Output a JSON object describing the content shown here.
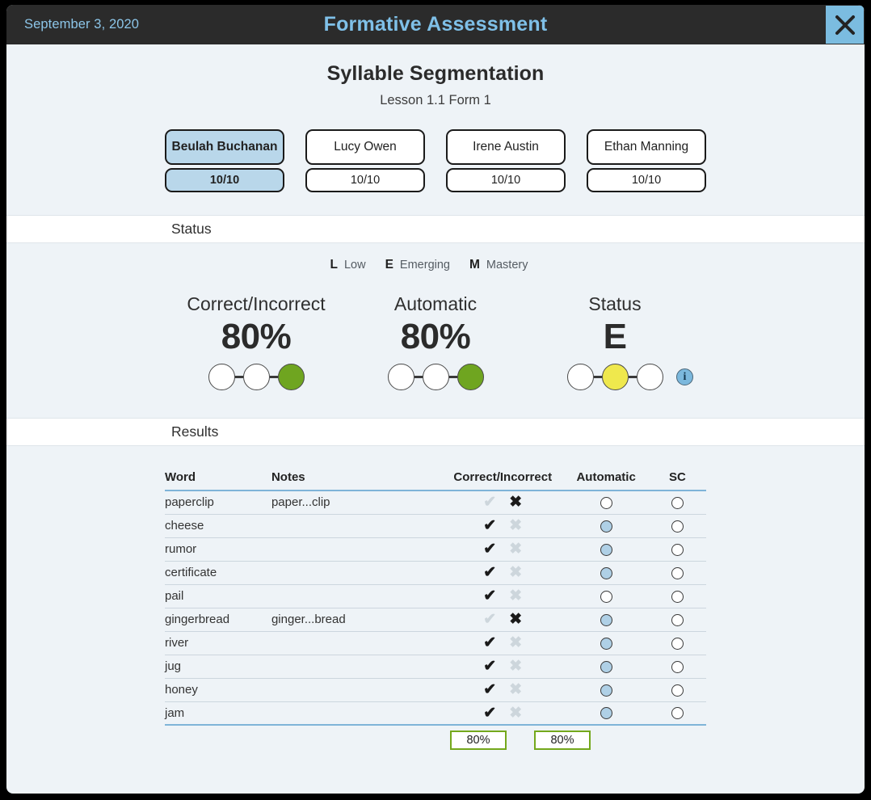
{
  "titlebar": {
    "date": "September 3, 2020",
    "title": "Formative Assessment",
    "close_label": "close-window",
    "accent_color": "#7bbce0",
    "bg_color": "#2b2b2b"
  },
  "assessment": {
    "title": "Syllable Segmentation",
    "subtitle": "Lesson 1.1 Form 1"
  },
  "students": [
    {
      "name": "Beulah Buchanan",
      "score": "10/10",
      "selected": true
    },
    {
      "name": "Lucy Owen",
      "score": "10/10",
      "selected": false
    },
    {
      "name": "Irene Austin",
      "score": "10/10",
      "selected": false
    },
    {
      "name": "Ethan Manning",
      "score": "10/10",
      "selected": false
    }
  ],
  "status_section": {
    "header": "Status",
    "legend": [
      {
        "key": "L",
        "label": "Low"
      },
      {
        "key": "E",
        "label": "Emerging"
      },
      {
        "key": "M",
        "label": "Mastery"
      }
    ],
    "metrics": [
      {
        "label": "Correct/Incorrect",
        "value": "80%",
        "dots": [
          "white",
          "white",
          "green"
        ],
        "has_info": false
      },
      {
        "label": "Automatic",
        "value": "80%",
        "dots": [
          "white",
          "white",
          "green"
        ],
        "has_info": false
      },
      {
        "label": "Status",
        "value": "E",
        "dots": [
          "white",
          "yellow",
          "white"
        ],
        "has_info": true,
        "info_glyph": "i"
      }
    ],
    "colors": {
      "green": "#6fa520",
      "yellow": "#efe84d",
      "white": "#ffffff"
    }
  },
  "results_section": {
    "header": "Results",
    "columns": [
      "Word",
      "Notes",
      "Correct/Incorrect",
      "Automatic",
      "SC"
    ],
    "rows": [
      {
        "word": "paperclip",
        "notes": "paper...clip",
        "correct": false,
        "automatic": false,
        "sc": false
      },
      {
        "word": "cheese",
        "notes": "",
        "correct": true,
        "automatic": true,
        "sc": false
      },
      {
        "word": "rumor",
        "notes": "",
        "correct": true,
        "automatic": true,
        "sc": false
      },
      {
        "word": "certificate",
        "notes": "",
        "correct": true,
        "automatic": true,
        "sc": false
      },
      {
        "word": "pail",
        "notes": "",
        "correct": true,
        "automatic": false,
        "sc": false
      },
      {
        "word": "gingerbread",
        "notes": "ginger...bread",
        "correct": false,
        "automatic": true,
        "sc": false
      },
      {
        "word": "river",
        "notes": "",
        "correct": true,
        "automatic": true,
        "sc": false
      },
      {
        "word": "jug",
        "notes": "",
        "correct": true,
        "automatic": true,
        "sc": false
      },
      {
        "word": "honey",
        "notes": "",
        "correct": true,
        "automatic": true,
        "sc": false
      },
      {
        "word": "jam",
        "notes": "",
        "correct": true,
        "automatic": true,
        "sc": false
      }
    ],
    "totals": {
      "correct_incorrect": "80%",
      "automatic": "80%",
      "box_border_color": "#74a81c"
    }
  }
}
